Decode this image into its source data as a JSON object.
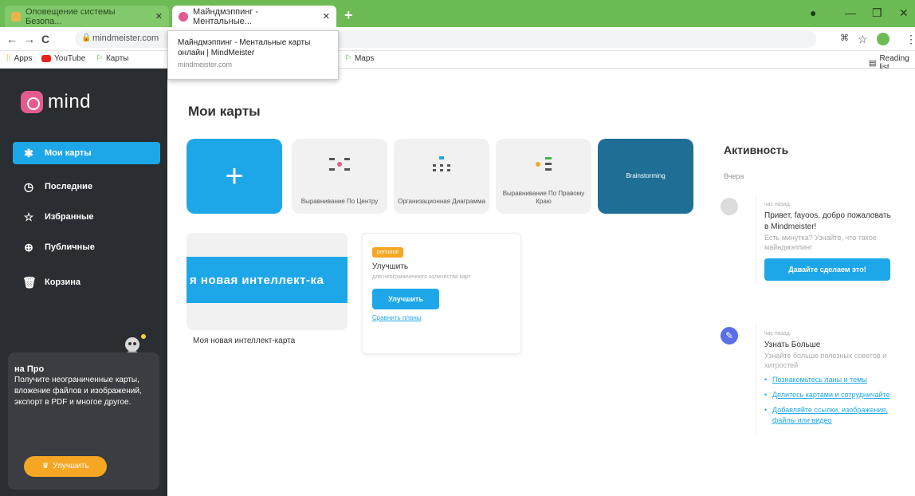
{
  "browser": {
    "tabs": [
      {
        "title": "Оповещение системы Безопа..."
      },
      {
        "title": "Майндмэппинг - Ментальные..."
      }
    ],
    "address": "mindmeister.com",
    "bookmarks": [
      "Apps",
      "YouTube",
      "Карты",
      "Maps"
    ],
    "reading_list": "Reading list",
    "tooltip": {
      "title": "Майндмэппинг - Ментальные карты онлайн | MindMeister",
      "url": "mindmeister.com"
    }
  },
  "sidebar": {
    "logo": "mind",
    "items": [
      {
        "label": "Мои карты",
        "icon": "mindmap-icon"
      },
      {
        "label": "Последние",
        "icon": "clock-icon"
      },
      {
        "label": "Избранные",
        "icon": "star-icon"
      },
      {
        "label": "Публичные",
        "icon": "globe-icon"
      },
      {
        "label": "Корзина",
        "icon": "trash-icon"
      }
    ],
    "promo": {
      "title": "на Про",
      "text": "Получите неограниченные карты, вложение файлов и изображений, экспорт в PDF и многое другое.",
      "button": "Улучшить"
    }
  },
  "main": {
    "title": "Мои карты",
    "templates": [
      {
        "label": "Выравнивание По Центру"
      },
      {
        "label": "Организационная Диаграмма"
      },
      {
        "label": "Выравнивание По Правому Краю"
      },
      {
        "label": "Brainstorming"
      }
    ],
    "map": {
      "thumb_text": "я новая интеллект-ка",
      "label": "Моя новая интеллект-карта"
    },
    "upgrade_card": {
      "badge": "personal",
      "title": "Улучшить",
      "desc": "для неограниченного количества карт",
      "button": "Улучшить",
      "link": "Сравнить планы"
    }
  },
  "activity": {
    "title": "Активность",
    "date": "Вчера",
    "items": [
      {
        "time": "час назад",
        "text": "Привет, fayoos, добро пожаловать в Mindmeister!",
        "muted": "Есть минутка? Узнайте, что такое майндмэппинг",
        "button": "Давайте сделаем это!"
      },
      {
        "time": "час назад",
        "text": "Узнать Больше",
        "muted": "Узнайте больше полезных советов и хитростей",
        "links": [
          "Познакомьтесь ланы и темы",
          "Делитесь картами и сотрудничайте",
          "Добавляйте ссылки, изображения, файлы или видео"
        ]
      }
    ]
  },
  "colors": {
    "accent": "#1ea7e8",
    "sidebar": "#2a2d31",
    "chrome": "#6dbb55",
    "promo_button": "#f5a623",
    "logo": "#e35b8f"
  }
}
